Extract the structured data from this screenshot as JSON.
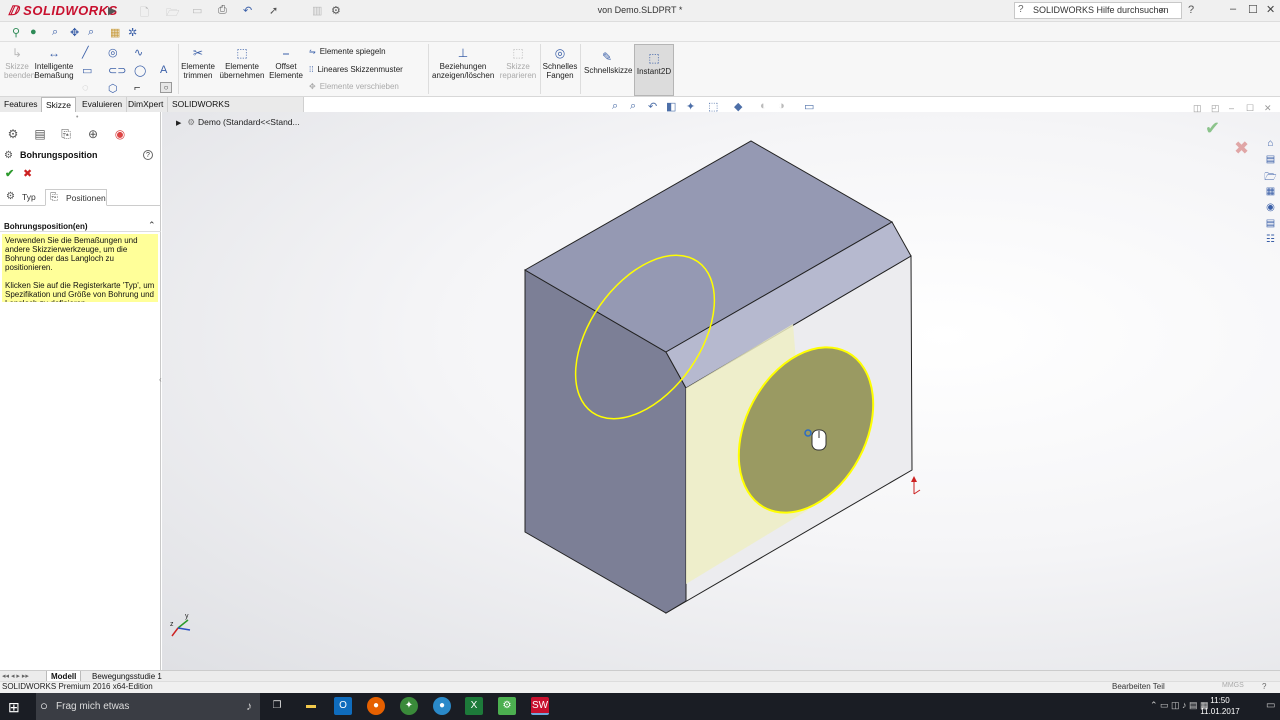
{
  "app": {
    "logo_text": "SOLIDWORKS",
    "document_title": "von Demo.SLDPRT *",
    "search_placeholder": "SOLIDWORKS Hilfe durchsuchen"
  },
  "ribbon": {
    "items": [
      {
        "label": "Skizze beenden",
        "icon": "exit-sketch-icon",
        "disabled": true
      },
      {
        "label": "Intelligente Bemaßung",
        "icon": "smart-dimension-icon"
      },
      {
        "label": "Elemente trimmen",
        "icon": "trim-icon"
      },
      {
        "label": "Elemente übernehmen",
        "icon": "convert-entities-icon"
      },
      {
        "label": "Offset Elemente",
        "icon": "offset-icon"
      },
      {
        "label": "Beziehungen anzeigen/löschen",
        "icon": "relations-icon"
      },
      {
        "label": "Skizze reparieren",
        "icon": "repair-sketch-icon",
        "disabled": true
      },
      {
        "label": "Schnelles Fangen",
        "icon": "quick-snaps-icon"
      },
      {
        "label": "Schnellskizze",
        "icon": "rapid-sketch-icon"
      },
      {
        "label": "Instant2D",
        "icon": "instant2d-icon",
        "active": true
      }
    ],
    "small_items": [
      {
        "label": "Elemente spiegeln",
        "disabled": false
      },
      {
        "label": "Lineares Skizzenmuster",
        "disabled": false
      },
      {
        "label": "Elemente verschieben",
        "disabled": true
      }
    ]
  },
  "tabs": [
    "Features",
    "Skizze",
    "Evaluieren",
    "DimXpert",
    "SOLIDWORKS Zusatzanwendungen"
  ],
  "active_tab": "Skizze",
  "property_manager": {
    "title": "Bohrungsposition",
    "tab_type": "Typ",
    "tab_positions": "Positionen",
    "group_title": "Bohrungsposition(en)",
    "message_1": "Verwenden Sie die Bemaßungen und andere Skizzierwerkzeuge, um die Bohrung oder das Langloch zu positionieren.",
    "message_2": "Klicken Sie auf die Registerkarte 'Typ', um Spezifikation und Größe von Bohrung und Langloch zu definieren."
  },
  "feature_tree": {
    "root": "Demo  (Standard<<Stand..."
  },
  "bottom_tabs": [
    "Modell",
    "Bewegungsstudie 1"
  ],
  "status": {
    "edition": "SOLIDWORKS Premium 2016 x64-Edition",
    "mode": "Bearbeiten Teil",
    "units": "MMGS"
  },
  "taskbar": {
    "search_text": "Frag mich etwas",
    "time": "11:50",
    "date": "11.01.2017"
  },
  "colors": {
    "accent_red": "#c8102e",
    "message_bg": "#ffff99",
    "face_top": "#9599b3",
    "face_left": "#7c7f96",
    "face_right": "#e9e9ec",
    "cylinder_face": "#9a9a62",
    "highlight": "#ffff00"
  }
}
